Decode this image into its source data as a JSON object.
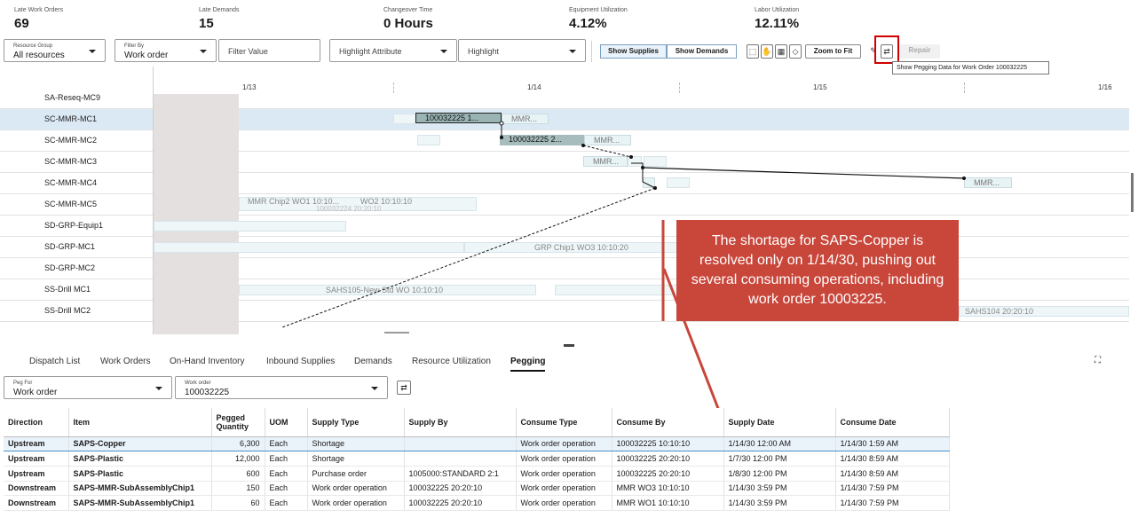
{
  "kpis": [
    {
      "label": "Late Work Orders",
      "value": "69"
    },
    {
      "label": "Late Demands",
      "value": "15"
    },
    {
      "label": "Changeover Time",
      "value": "0 Hours"
    },
    {
      "label": "Equipment Utilization",
      "value": "4.12%"
    },
    {
      "label": "Labor Utilization",
      "value": "12.11%"
    }
  ],
  "toolbar": {
    "resource_group_label": "Resource Group",
    "resource_group_value": "All resources",
    "filter_by_label": "Filter By",
    "filter_by_value": "Work order",
    "filter_value_placeholder": "Filter Value",
    "highlight_attribute_placeholder": "Highlight Attribute",
    "highlight_placeholder": "Highlight",
    "show_supplies": "Show Supplies",
    "show_demands": "Show Demands",
    "zoom_to_fit": "Zoom to Fit",
    "repair": "Repair",
    "tooltip": "Show Pegging Data for Work Order 100032225"
  },
  "gantt": {
    "dates": [
      "1/13",
      "1/14",
      "1/15",
      "1/16"
    ],
    "rows": [
      "SA-Reseq-MC9",
      "SC-MMR-MC1",
      "SC-MMR-MC2",
      "SC-MMR-MC3",
      "SC-MMR-MC4",
      "SC-MMR-MC5",
      "SD-GRP-Equip1",
      "SD-GRP-MC1",
      "SD-GRP-MC2",
      "SS-Drill MC1",
      "SS-Drill MC2"
    ],
    "bars": {
      "mc1_main": "100032225 1...",
      "mc1_next": "MMR...",
      "mc2_main": "100032225 2...",
      "mc2_next": "MMR...",
      "mc3_main": "MMR...",
      "mc4_far": "MMR...",
      "mc5_a": "MMR Chip2 WO1 10:10...",
      "mc5_b": "WO2 10:10:10",
      "mc5_under": "100032224 20:20:10",
      "grp_mc1": "GRP Chip1 WO3 10:10:20",
      "drill1": "SAHS105-New Std WO 10:10:10",
      "drill2": "SAHS104 20:20:10"
    }
  },
  "callout": "The shortage for SAPS-Copper is resolved only on 1/14/30, pushing out several consuming operations, including work order 10003225.",
  "tabs": [
    "Dispatch List",
    "Work Orders",
    "On-Hand Inventory",
    "Inbound Supplies",
    "Demands",
    "Resource Utilization",
    "Pegging"
  ],
  "active_tab": "Pegging",
  "pegging": {
    "peg_for_label": "Peg For",
    "peg_for_value": "Work order",
    "work_order_label": "Work order",
    "work_order_value": "100032225",
    "columns": [
      "Direction",
      "Item",
      "Pegged Quantity",
      "UOM",
      "Supply Type",
      "Supply By",
      "Consume Type",
      "Consume By",
      "Supply Date",
      "Consume Date"
    ],
    "rows": [
      [
        "Upstream",
        "SAPS-Copper",
        "6,300",
        "Each",
        "Shortage",
        "",
        "Work order operation",
        "100032225 10:10:10",
        "1/14/30 12:00 AM",
        "1/14/30 1:59 AM"
      ],
      [
        "Upstream",
        "SAPS-Plastic",
        "12,000",
        "Each",
        "Shortage",
        "",
        "Work order operation",
        "100032225 20:20:10",
        "1/7/30 12:00 PM",
        "1/14/30 8:59 AM"
      ],
      [
        "Upstream",
        "SAPS-Plastic",
        "600",
        "Each",
        "Purchase order",
        "1005000:STANDARD 2:1",
        "Work order operation",
        "100032225 20:20:10",
        "1/8/30 12:00 PM",
        "1/14/30 8:59 AM"
      ],
      [
        "Downstream",
        "SAPS-MMR-SubAssemblyChip1",
        "150",
        "Each",
        "Work order operation",
        "100032225 20:20:10",
        "Work order operation",
        "MMR WO3 10:10:10",
        "1/14/30 3:59 PM",
        "1/14/30 7:59 PM"
      ],
      [
        "Downstream",
        "SAPS-MMR-SubAssemblyChip1",
        "60",
        "Each",
        "Work order operation",
        "100032225 20:20:10",
        "Work order operation",
        "MMR WO1 10:10:10",
        "1/14/30 3:59 PM",
        "1/14/30 7:59 PM"
      ]
    ]
  }
}
